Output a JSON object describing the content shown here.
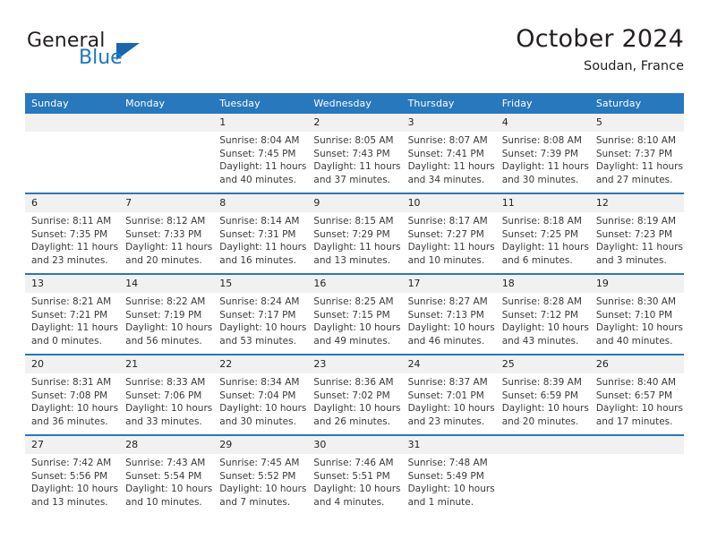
{
  "brand": {
    "word_one": "General",
    "word_two": "Blue",
    "triangle_icon": "triangle-icon",
    "accent_color": "#1667b0"
  },
  "header": {
    "month_title": "October 2024",
    "location": "Soudan, France"
  },
  "calendar": {
    "header_color": "#2878bd",
    "daynum_band_color": "#f1f1f1",
    "weekday_headers": [
      "Sunday",
      "Monday",
      "Tuesday",
      "Wednesday",
      "Thursday",
      "Friday",
      "Saturday"
    ],
    "weeks": [
      [
        {
          "day": "",
          "lines": []
        },
        {
          "day": "",
          "lines": []
        },
        {
          "day": "1",
          "lines": [
            "Sunrise: 8:04 AM",
            "Sunset: 7:45 PM",
            "Daylight: 11 hours",
            "and 40 minutes."
          ]
        },
        {
          "day": "2",
          "lines": [
            "Sunrise: 8:05 AM",
            "Sunset: 7:43 PM",
            "Daylight: 11 hours",
            "and 37 minutes."
          ]
        },
        {
          "day": "3",
          "lines": [
            "Sunrise: 8:07 AM",
            "Sunset: 7:41 PM",
            "Daylight: 11 hours",
            "and 34 minutes."
          ]
        },
        {
          "day": "4",
          "lines": [
            "Sunrise: 8:08 AM",
            "Sunset: 7:39 PM",
            "Daylight: 11 hours",
            "and 30 minutes."
          ]
        },
        {
          "day": "5",
          "lines": [
            "Sunrise: 8:10 AM",
            "Sunset: 7:37 PM",
            "Daylight: 11 hours",
            "and 27 minutes."
          ]
        }
      ],
      [
        {
          "day": "6",
          "lines": [
            "Sunrise: 8:11 AM",
            "Sunset: 7:35 PM",
            "Daylight: 11 hours",
            "and 23 minutes."
          ]
        },
        {
          "day": "7",
          "lines": [
            "Sunrise: 8:12 AM",
            "Sunset: 7:33 PM",
            "Daylight: 11 hours",
            "and 20 minutes."
          ]
        },
        {
          "day": "8",
          "lines": [
            "Sunrise: 8:14 AM",
            "Sunset: 7:31 PM",
            "Daylight: 11 hours",
            "and 16 minutes."
          ]
        },
        {
          "day": "9",
          "lines": [
            "Sunrise: 8:15 AM",
            "Sunset: 7:29 PM",
            "Daylight: 11 hours",
            "and 13 minutes."
          ]
        },
        {
          "day": "10",
          "lines": [
            "Sunrise: 8:17 AM",
            "Sunset: 7:27 PM",
            "Daylight: 11 hours",
            "and 10 minutes."
          ]
        },
        {
          "day": "11",
          "lines": [
            "Sunrise: 8:18 AM",
            "Sunset: 7:25 PM",
            "Daylight: 11 hours",
            "and 6 minutes."
          ]
        },
        {
          "day": "12",
          "lines": [
            "Sunrise: 8:19 AM",
            "Sunset: 7:23 PM",
            "Daylight: 11 hours",
            "and 3 minutes."
          ]
        }
      ],
      [
        {
          "day": "13",
          "lines": [
            "Sunrise: 8:21 AM",
            "Sunset: 7:21 PM",
            "Daylight: 11 hours",
            "and 0 minutes."
          ]
        },
        {
          "day": "14",
          "lines": [
            "Sunrise: 8:22 AM",
            "Sunset: 7:19 PM",
            "Daylight: 10 hours",
            "and 56 minutes."
          ]
        },
        {
          "day": "15",
          "lines": [
            "Sunrise: 8:24 AM",
            "Sunset: 7:17 PM",
            "Daylight: 10 hours",
            "and 53 minutes."
          ]
        },
        {
          "day": "16",
          "lines": [
            "Sunrise: 8:25 AM",
            "Sunset: 7:15 PM",
            "Daylight: 10 hours",
            "and 49 minutes."
          ]
        },
        {
          "day": "17",
          "lines": [
            "Sunrise: 8:27 AM",
            "Sunset: 7:13 PM",
            "Daylight: 10 hours",
            "and 46 minutes."
          ]
        },
        {
          "day": "18",
          "lines": [
            "Sunrise: 8:28 AM",
            "Sunset: 7:12 PM",
            "Daylight: 10 hours",
            "and 43 minutes."
          ]
        },
        {
          "day": "19",
          "lines": [
            "Sunrise: 8:30 AM",
            "Sunset: 7:10 PM",
            "Daylight: 10 hours",
            "and 40 minutes."
          ]
        }
      ],
      [
        {
          "day": "20",
          "lines": [
            "Sunrise: 8:31 AM",
            "Sunset: 7:08 PM",
            "Daylight: 10 hours",
            "and 36 minutes."
          ]
        },
        {
          "day": "21",
          "lines": [
            "Sunrise: 8:33 AM",
            "Sunset: 7:06 PM",
            "Daylight: 10 hours",
            "and 33 minutes."
          ]
        },
        {
          "day": "22",
          "lines": [
            "Sunrise: 8:34 AM",
            "Sunset: 7:04 PM",
            "Daylight: 10 hours",
            "and 30 minutes."
          ]
        },
        {
          "day": "23",
          "lines": [
            "Sunrise: 8:36 AM",
            "Sunset: 7:02 PM",
            "Daylight: 10 hours",
            "and 26 minutes."
          ]
        },
        {
          "day": "24",
          "lines": [
            "Sunrise: 8:37 AM",
            "Sunset: 7:01 PM",
            "Daylight: 10 hours",
            "and 23 minutes."
          ]
        },
        {
          "day": "25",
          "lines": [
            "Sunrise: 8:39 AM",
            "Sunset: 6:59 PM",
            "Daylight: 10 hours",
            "and 20 minutes."
          ]
        },
        {
          "day": "26",
          "lines": [
            "Sunrise: 8:40 AM",
            "Sunset: 6:57 PM",
            "Daylight: 10 hours",
            "and 17 minutes."
          ]
        }
      ],
      [
        {
          "day": "27",
          "lines": [
            "Sunrise: 7:42 AM",
            "Sunset: 5:56 PM",
            "Daylight: 10 hours",
            "and 13 minutes."
          ]
        },
        {
          "day": "28",
          "lines": [
            "Sunrise: 7:43 AM",
            "Sunset: 5:54 PM",
            "Daylight: 10 hours",
            "and 10 minutes."
          ]
        },
        {
          "day": "29",
          "lines": [
            "Sunrise: 7:45 AM",
            "Sunset: 5:52 PM",
            "Daylight: 10 hours",
            "and 7 minutes."
          ]
        },
        {
          "day": "30",
          "lines": [
            "Sunrise: 7:46 AM",
            "Sunset: 5:51 PM",
            "Daylight: 10 hours",
            "and 4 minutes."
          ]
        },
        {
          "day": "31",
          "lines": [
            "Sunrise: 7:48 AM",
            "Sunset: 5:49 PM",
            "Daylight: 10 hours",
            "and 1 minute."
          ]
        },
        {
          "day": "",
          "lines": []
        },
        {
          "day": "",
          "lines": []
        }
      ]
    ]
  }
}
